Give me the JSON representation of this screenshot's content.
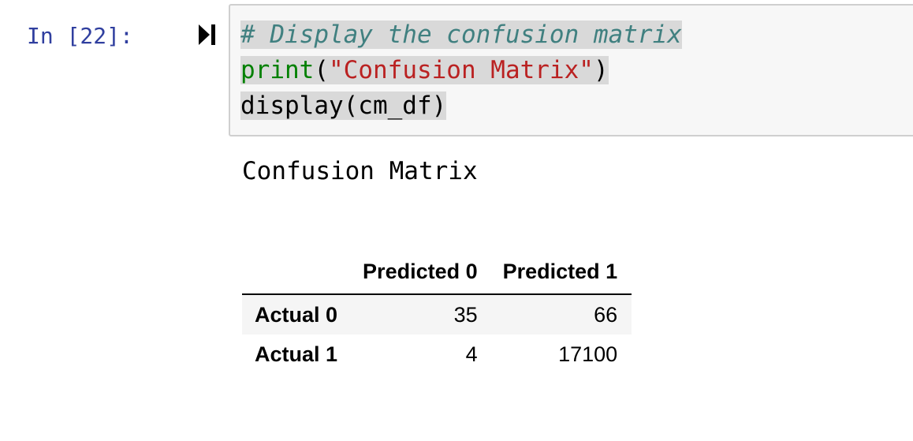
{
  "cell": {
    "prompt": "In [22]:",
    "run_icon": "run-to-cursor-icon",
    "code_lines": [
      [
        {
          "type": "comment",
          "text": "# Display the confusion matrix"
        }
      ],
      [
        {
          "type": "builtin",
          "text": "print"
        },
        {
          "type": "plain",
          "text": "("
        },
        {
          "type": "string",
          "text": "\"Confusion Matrix\""
        },
        {
          "type": "plain",
          "text": ")"
        }
      ],
      [
        {
          "type": "plain",
          "text": "display(cm_df)"
        }
      ]
    ]
  },
  "output": {
    "stdout": "Confusion Matrix",
    "table": {
      "columns": [
        "",
        "Predicted 0",
        "Predicted 1"
      ],
      "rows": [
        {
          "index": "Actual 0",
          "values": [
            "35",
            "66"
          ]
        },
        {
          "index": "Actual 1",
          "values": [
            "4",
            "17100"
          ]
        }
      ]
    }
  },
  "colors": {
    "prompt": "#303f9f",
    "comment": "#408080",
    "builtin": "#008000",
    "string": "#ba2121",
    "highlight": "#d9d9d9",
    "input_bg": "#f7f7f7",
    "input_border": "#cfcfcf"
  }
}
